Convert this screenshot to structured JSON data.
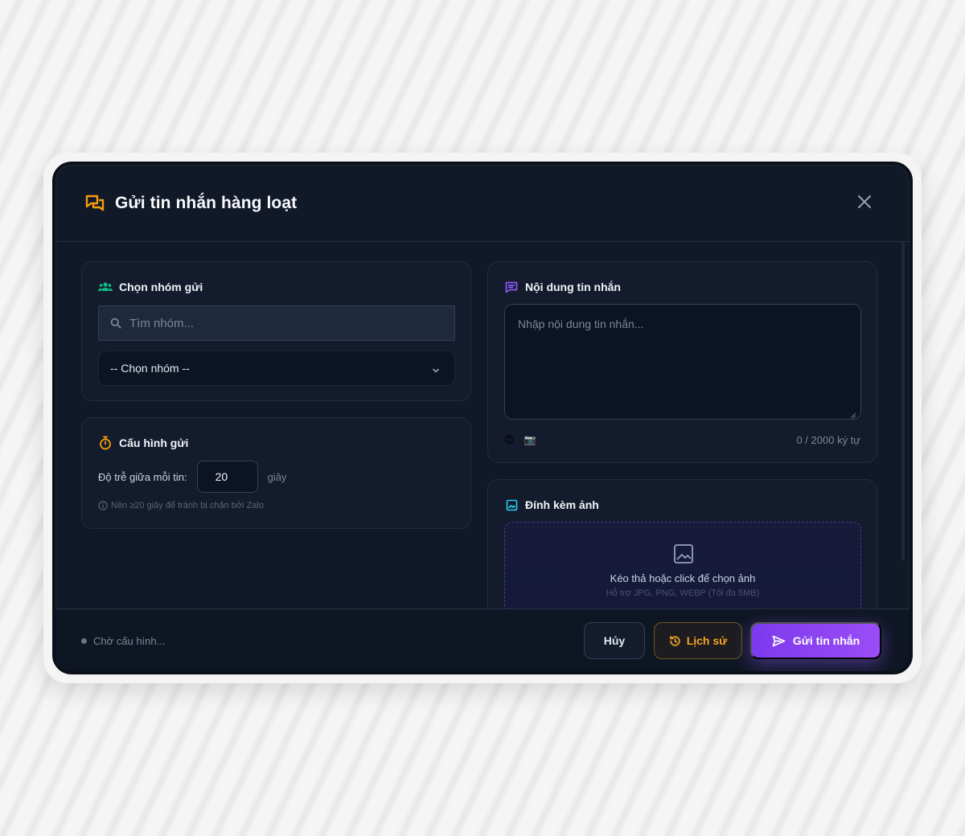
{
  "modal": {
    "title": "Gửi tin nhắn hàng loạt"
  },
  "group_card": {
    "title": "Chọn nhóm gửi",
    "search_placeholder": "Tìm nhóm...",
    "select_value": "-- Chọn nhóm --"
  },
  "config_card": {
    "title": "Cấu hình gửi",
    "delay_label": "Độ trễ giữa mỗi tin:",
    "delay_value": "20",
    "delay_unit": "giây",
    "hint": "Nên ≥20 giây để tránh bị chặn bởi Zalo"
  },
  "message_card": {
    "title": "Nội dung tin nhắn",
    "placeholder": "Nhập nội dung tin nhắn...",
    "counter": "0 / 2000 ký tự",
    "emoji_icon": "😊",
    "camera_icon": "📷"
  },
  "attach_card": {
    "title": "Đính kèm ảnh",
    "drop_text": "Kéo thả hoặc click để chọn ảnh",
    "drop_sub": "Hỗ trợ JPG, PNG, WEBP (Tối đa 5MB)"
  },
  "footer": {
    "status": "Chờ cấu hình...",
    "cancel_label": "Hủy",
    "history_label": "Lịch sử",
    "send_label": "Gửi tin nhắn"
  },
  "colors": {
    "accent_orange": "#f59e0b",
    "accent_purple": "#8b5cf6",
    "accent_green": "#10b981",
    "accent_cyan": "#22d3ee"
  }
}
